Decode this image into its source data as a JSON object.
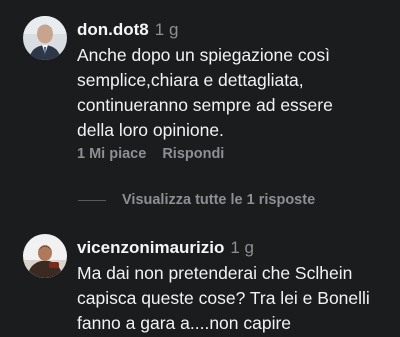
{
  "comments": [
    {
      "username": "don.dot8",
      "time": "1 g",
      "text": "Anche dopo un spiegazione così\nsemplice,chiara e dettagliata,\ncontinueranno sempre ad essere\ndella loro opinione.",
      "likes_label": "1 Mi piace",
      "reply_label": "Rispondi",
      "view_replies_label": "Visualizza tutte le 1 risposte"
    },
    {
      "username": "vicenzonimaurizio",
      "time": "1 g",
      "text": "Ma dai non pretenderai che Sclhein\ncapisca queste cose? Tra lei e Bonelli\nfanno a gara a....non capire"
    }
  ]
}
